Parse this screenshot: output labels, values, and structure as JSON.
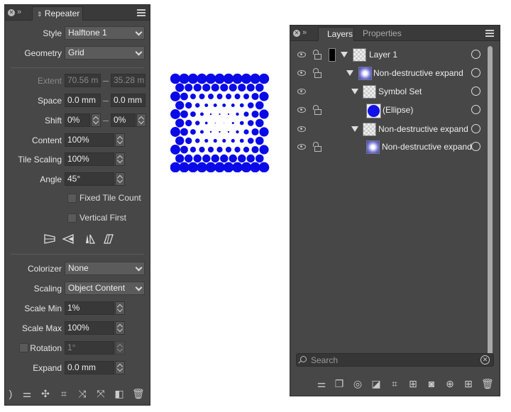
{
  "repeater": {
    "tab_title": "Repeater",
    "style": {
      "label": "Style",
      "value": "Halftone 1"
    },
    "geometry": {
      "label": "Geometry",
      "value": "Grid"
    },
    "extent": {
      "label": "Extent",
      "value1": "70.56 m",
      "value2": "35.28 m"
    },
    "space": {
      "label": "Space",
      "value1": "0.0 mm",
      "value2": "0.0 mm"
    },
    "shift": {
      "label": "Shift",
      "value1": "0%",
      "value2": "0%"
    },
    "content": {
      "label": "Content",
      "value": "100%"
    },
    "tile_scaling": {
      "label": "Tile Scaling",
      "value": "100%"
    },
    "angle": {
      "label": "Angle",
      "value": "45°"
    },
    "fixed_tile_count": "Fixed Tile Count",
    "vertical_first": "Vertical First",
    "colorizer": {
      "label": "Colorizer",
      "value": "None"
    },
    "scaling": {
      "label": "Scaling",
      "value": "Object Content"
    },
    "scale_min": {
      "label": "Scale Min",
      "value": "1%"
    },
    "scale_max": {
      "label": "Scale Max",
      "value": "100%"
    },
    "rotation": {
      "label": "Rotation",
      "value": "1°"
    },
    "expand": {
      "label": "Expand",
      "value": "0.0 mm"
    }
  },
  "layers_panel": {
    "tabs": [
      "Layers",
      "Properties"
    ],
    "rows": [
      {
        "name": "Layer 1"
      },
      {
        "name": "Non-destructive expand"
      },
      {
        "name": "Symbol Set"
      },
      {
        "name": "(Ellipse)"
      },
      {
        "name": "Non-destructive expand"
      },
      {
        "name": "Non-destructive expand"
      }
    ],
    "search_placeholder": "Search"
  },
  "canvas": {
    "dot_color": "#0a0ae8"
  }
}
